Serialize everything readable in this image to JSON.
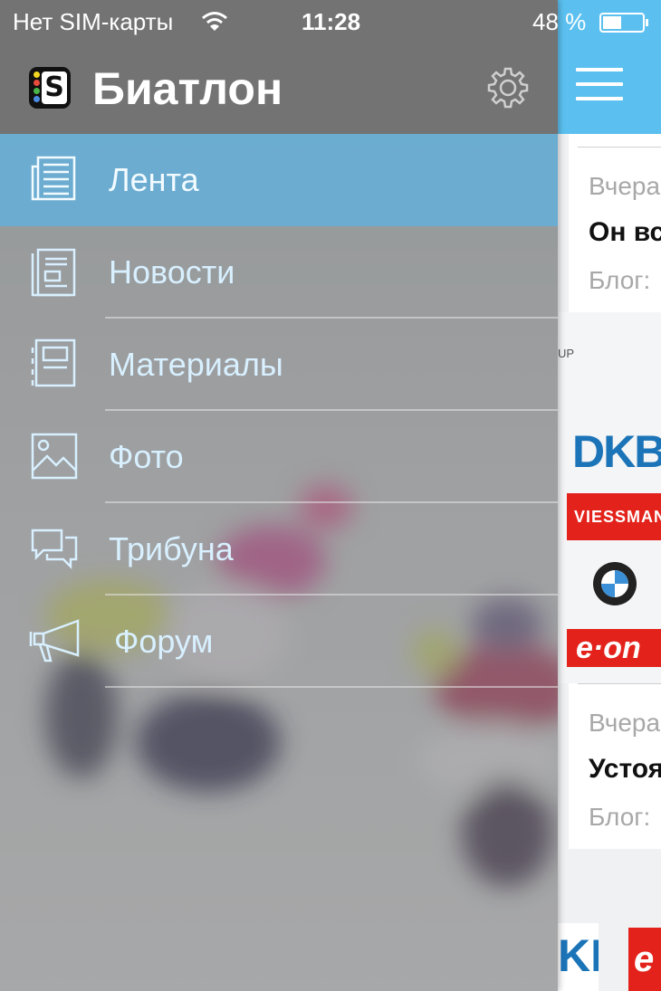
{
  "status_bar": {
    "carrier": "Нет SIM-карты",
    "time": "11:28",
    "battery_text": "48 %",
    "battery_level": 0.48
  },
  "drawer": {
    "app_title": "Биатлон",
    "logo_letter": "S",
    "menu": [
      {
        "label": "Лента",
        "icon": "newspaper-icon",
        "active": true
      },
      {
        "label": "Новости",
        "icon": "news-document-icon",
        "active": false
      },
      {
        "label": "Материалы",
        "icon": "materials-icon",
        "active": false
      },
      {
        "label": "Фото",
        "icon": "photo-icon",
        "active": false
      },
      {
        "label": "Трибуна",
        "icon": "chat-bubbles-icon",
        "active": false
      },
      {
        "label": "Форум",
        "icon": "megaphone-icon",
        "active": false
      }
    ]
  },
  "feed": {
    "cards": [
      {
        "meta": "Вчера",
        "title": "Он вс",
        "blog": "Блог:"
      },
      {
        "meta": "Вчера",
        "title": "Устоя",
        "blog": "Блог:"
      }
    ],
    "sponsors": {
      "up": "UP",
      "dkb": "DKB",
      "viessmann": "VIESSMANN",
      "bmw": "BMW",
      "eon": "e·on",
      "kb": "KB",
      "e": "e"
    }
  },
  "colors": {
    "accent": "#5bc0f0",
    "active_item": "#64afda",
    "sponsor_red": "#e3231b",
    "sponsor_blue": "#1c74b8"
  }
}
